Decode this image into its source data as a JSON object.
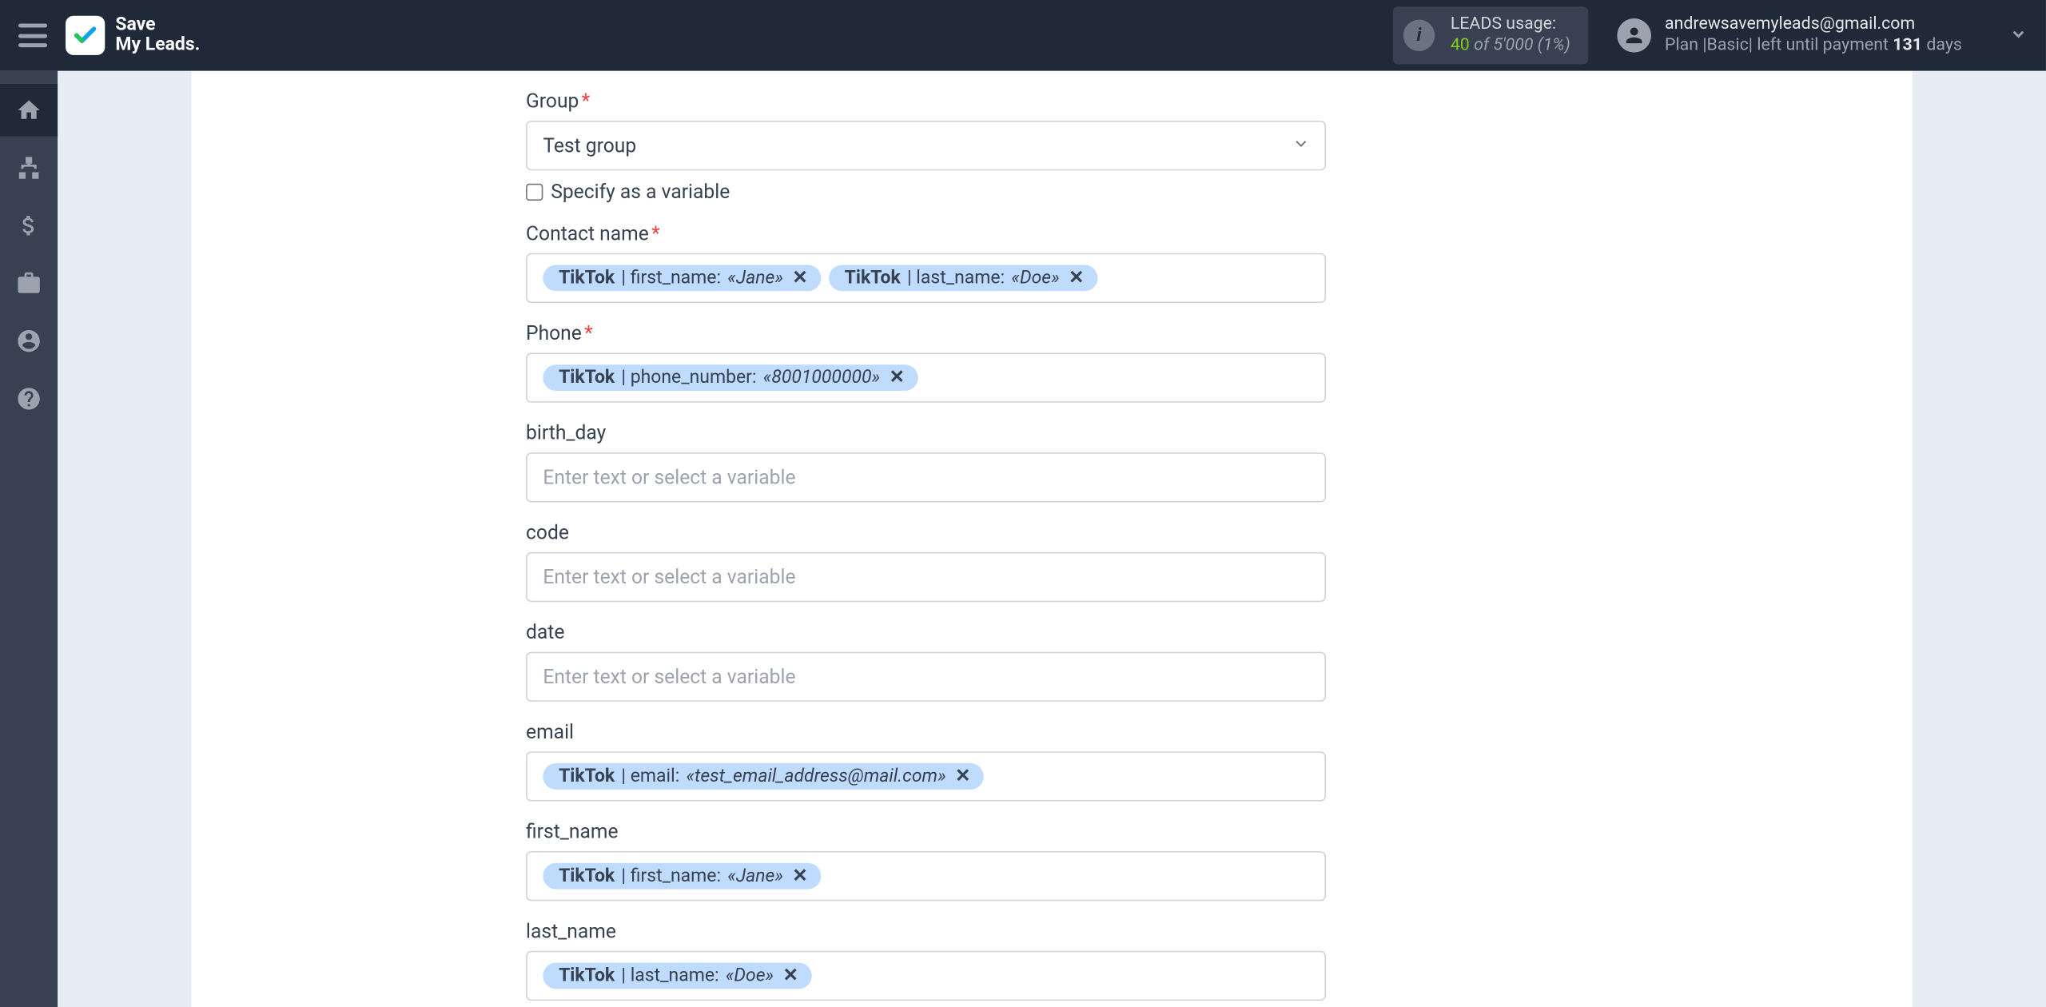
{
  "brand": {
    "line1": "Save",
    "line2": "My Leads."
  },
  "usage": {
    "title": "LEADS usage:",
    "count": "40",
    "of": "of",
    "limit": "5'000",
    "pct": "(1%)"
  },
  "account": {
    "email": "andrewsavemyleads@gmail.com",
    "plan_prefix": "Plan |",
    "plan_name": "Basic",
    "plan_suffix": "| left until payment",
    "days_count": "131",
    "days_label": "days"
  },
  "form": {
    "group_label": "Group",
    "group_value": "Test group",
    "specify_label": "Specify as a variable",
    "contact_label": "Contact name",
    "phone_label": "Phone",
    "birth_label": "birth_day",
    "code_label": "code",
    "date_label": "date",
    "email_label": "email",
    "firstname_label": "first_name",
    "lastname_label": "last_name",
    "placeholder": "Enter text or select a variable"
  },
  "tags": {
    "source": "TikTok",
    "first_name_field": " | first_name:",
    "first_name_val": "«Jane»",
    "last_name_field": " | last_name:",
    "last_name_val": "«Doe»",
    "phone_field": " | phone_number:",
    "phone_val": "«8001000000»",
    "email_field": " | email:",
    "email_val": "«test_email_address@mail.com»"
  }
}
